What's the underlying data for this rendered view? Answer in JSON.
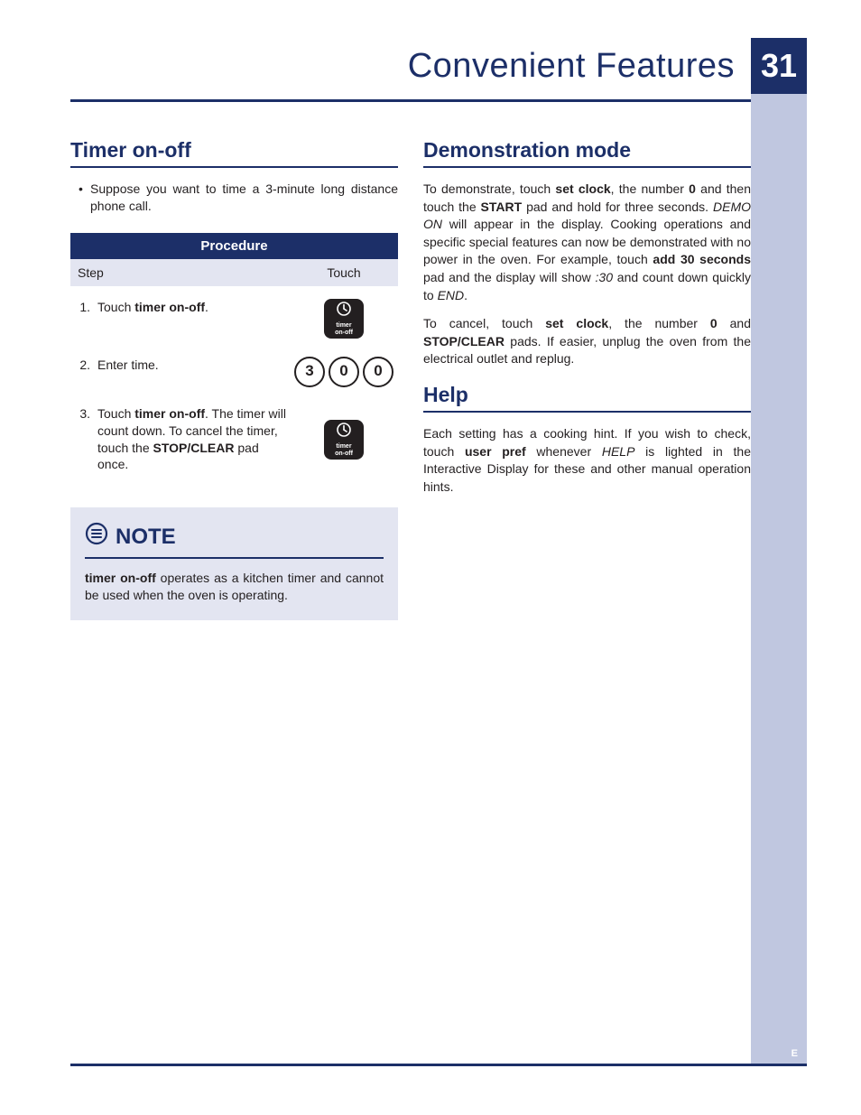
{
  "header": {
    "title": "Convenient Features",
    "page_number": "31"
  },
  "left": {
    "section1": {
      "title": "Timer on-off",
      "intro": "Suppose you want to time a 3-minute long distance phone call.",
      "table": {
        "header": "Procedure",
        "col_step": "Step",
        "col_touch": "Touch",
        "rows": [
          {
            "num": "1.",
            "text_pre": "Touch ",
            "text_bold": "timer on-off",
            "text_post": ".",
            "icon_label_line1": "timer",
            "icon_label_line2": "on-off"
          },
          {
            "num": "2.",
            "text": "Enter time.",
            "digits": [
              "3",
              "0",
              "0"
            ]
          },
          {
            "num": "3.",
            "text_pre": "Touch ",
            "text_bold1": "timer on-off",
            "text_mid": ". The timer will count down. To cancel the timer, touch the ",
            "text_bold2": "STOP/CLEAR",
            "text_post": " pad once.",
            "icon_label_line1": "timer",
            "icon_label_line2": "on-off"
          }
        ]
      }
    },
    "note": {
      "label": "NOTE",
      "body_bold": "timer on-off",
      "body_rest": " operates as a kitchen timer and cannot be used when the oven is operating."
    }
  },
  "right": {
    "section1": {
      "title": "Demonstration mode",
      "p1": {
        "t1": "To demonstrate, touch ",
        "b1": "set clock",
        "t2": ", the number ",
        "b2": "0",
        "t3": " and then touch the ",
        "b3": "START",
        "t4": " pad and hold for three seconds. ",
        "i1": "DEMO ON",
        "t5": " will appear in the display. Cooking operations and specific special features can now be demonstrated with no power in the oven. For example, touch ",
        "b4": "add 30 seconds",
        "t6": " pad and the display will show ",
        "i2": ":30",
        "t7": " and count down quickly to ",
        "i3": "END",
        "t8": "."
      },
      "p2": {
        "t1": "To cancel, touch ",
        "b1": "set clock",
        "t2": ", the number ",
        "b2": "0",
        "t3": " and ",
        "b3": "STOP/CLEAR",
        "t4": " pads. If easier, unplug the oven from the electrical outlet and replug."
      }
    },
    "section2": {
      "title": "Help",
      "p1": {
        "t1": "Each setting has a cooking hint. If you wish to check, touch ",
        "b1": "user pref",
        "t2": " whenever ",
        "i1": "HELP",
        "t3": " is lighted in the Interactive Display for these and other manual operation hints."
      }
    }
  },
  "footer": {
    "lang": "E"
  }
}
